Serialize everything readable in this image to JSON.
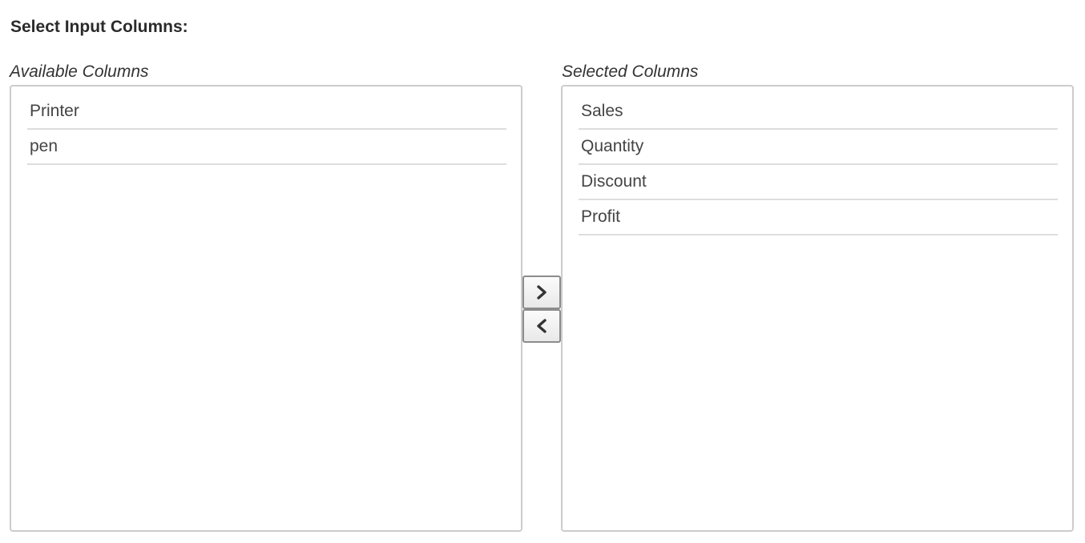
{
  "header": {
    "title": "Select Input Columns:"
  },
  "available": {
    "label": "Available Columns",
    "items": [
      "Printer",
      "pen"
    ]
  },
  "selected": {
    "label": "Selected Columns",
    "items": [
      "Sales",
      "Quantity",
      "Discount",
      "Profit"
    ]
  },
  "controls": {
    "move_right_icon": "chevron-right-icon",
    "move_left_icon": "chevron-left-icon"
  }
}
